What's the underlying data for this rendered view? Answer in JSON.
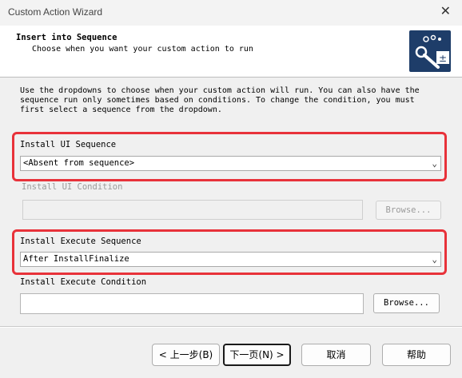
{
  "window": {
    "title": "Custom Action Wizard",
    "close_glyph": "✕"
  },
  "header": {
    "title": "Insert into Sequence",
    "subtitle": "Choose when you want your custom action to run",
    "icon": "wizard-custom-action-icon"
  },
  "description": [
    "Use the dropdowns to choose when your custom action will run. You can also have the",
    "sequence run only sometimes based on conditions. To change the condition, you must",
    "first select a sequence from the dropdown."
  ],
  "ui_sequence": {
    "label": "Install UI Sequence",
    "value": "<Absent from sequence>"
  },
  "ui_condition": {
    "label": "Install UI Condition",
    "value": "",
    "browse_label": "Browse..."
  },
  "execute_sequence": {
    "label": "Install Execute Sequence",
    "value": "After InstallFinalize"
  },
  "execute_condition": {
    "label": "Install Execute Condition",
    "value": "",
    "browse_label": "Browse..."
  },
  "footer": {
    "back": "< 上一步(B)",
    "next": "下一页(N) >",
    "cancel": "取消",
    "help": "帮助"
  },
  "colors": {
    "highlight": "#e8323a",
    "icon_bg": "#1e3d69"
  }
}
